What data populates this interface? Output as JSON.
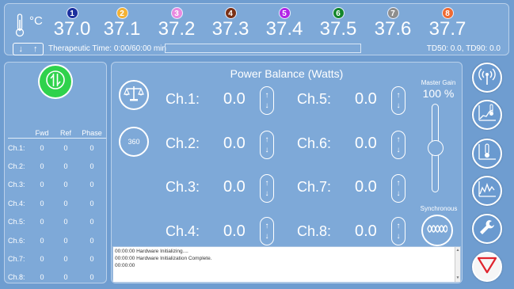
{
  "header": {
    "unit": "°C",
    "channels": [
      {
        "num": "1",
        "temp": "37.0",
        "color": "#1b2f9e"
      },
      {
        "num": "2",
        "temp": "37.1",
        "color": "#f3b235"
      },
      {
        "num": "3",
        "temp": "37.2",
        "color": "#ea8ae0"
      },
      {
        "num": "4",
        "temp": "37.3",
        "color": "#7b3116"
      },
      {
        "num": "5",
        "temp": "37.4",
        "color": "#b125e6"
      },
      {
        "num": "6",
        "temp": "37.5",
        "color": "#13862b"
      },
      {
        "num": "7",
        "temp": "37.6",
        "color": "#8e8e8e"
      },
      {
        "num": "8",
        "temp": "37.7",
        "color": "#ef6a32"
      }
    ],
    "arrow_down": "↓",
    "arrow_up": "↑",
    "therapeutic_time": "Therapeutic Time: 0:00/60:00 min",
    "td_values": "TD50: 0.0, TD90: 0.0"
  },
  "left": {
    "table": {
      "headers": [
        "",
        "Fwd",
        "Ref",
        "Phase"
      ],
      "rows": [
        [
          "Ch.1:",
          "0",
          "0",
          "0"
        ],
        [
          "Ch.2:",
          "0",
          "0",
          "0"
        ],
        [
          "Ch.3:",
          "0",
          "0",
          "0"
        ],
        [
          "Ch.4:",
          "0",
          "0",
          "0"
        ],
        [
          "Ch.5:",
          "0",
          "0",
          "0"
        ],
        [
          "Ch.6:",
          "0",
          "0",
          "0"
        ],
        [
          "Ch.7:",
          "0",
          "0",
          "0"
        ],
        [
          "Ch.8:",
          "0",
          "0",
          "0"
        ]
      ]
    }
  },
  "center": {
    "title": "Power Balance (Watts)",
    "icon_360": "360",
    "channels": [
      {
        "label": "Ch.1:",
        "value": "0.0"
      },
      {
        "label": "Ch.2:",
        "value": "0.0"
      },
      {
        "label": "Ch.3:",
        "value": "0.0"
      },
      {
        "label": "Ch.4:",
        "value": "0.0"
      },
      {
        "label": "Ch.5:",
        "value": "0.0"
      },
      {
        "label": "Ch.6:",
        "value": "0.0"
      },
      {
        "label": "Ch.7:",
        "value": "0.0"
      },
      {
        "label": "Ch.8:",
        "value": "0.0"
      }
    ],
    "spin_up": "↑",
    "spin_down": "↓",
    "master_gain_label": "Master Gain",
    "master_gain_value": "100 %",
    "master_gain_level": 0.5,
    "sync_label": "Synchronous",
    "log": [
      "00:00:00 Hardware Initializing....",
      "00:00:00 Hardware Initialization Complete.",
      "00:00:00"
    ]
  },
  "toolbar": {
    "accent": "#6a9ad0",
    "stop_color": "#e0242e"
  }
}
